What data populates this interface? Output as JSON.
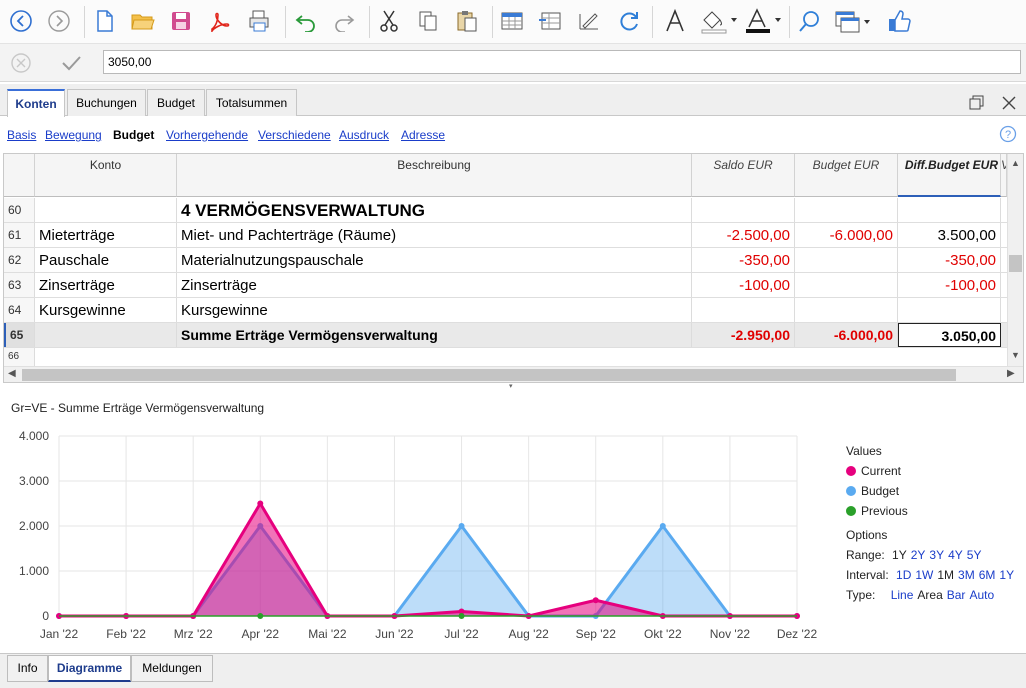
{
  "toolbar": {
    "icons": [
      "back-icon",
      "forward-icon",
      "new-file-icon",
      "open-folder-icon",
      "save-icon",
      "pdf-icon",
      "print-icon",
      "undo-icon",
      "redo-icon",
      "cut-icon",
      "copy-icon",
      "paste-icon",
      "add-rows-icon",
      "insert-rows-icon",
      "edit-icon",
      "refresh-icon",
      "font-icon",
      "fill-color-icon",
      "text-color-icon",
      "search-icon",
      "window-icon",
      "thumbs-up-icon"
    ]
  },
  "editbar": {
    "cell_value": "3050,00"
  },
  "tabs": [
    "Konten",
    "Buchungen",
    "Budget",
    "Totalsummen"
  ],
  "views": [
    "Basis",
    "Bewegung",
    "Budget",
    "Vorhergehende",
    "Verschiedene",
    "Ausdruck",
    "Adresse"
  ],
  "grid": {
    "headers": {
      "konto": "Konto",
      "beschreibung": "Beschreibung",
      "saldo": "Saldo EUR",
      "budget": "Budget EUR",
      "diff": "Diff.Budget EUR",
      "extra": "V"
    },
    "rows": [
      {
        "n": "60",
        "konto": "",
        "desc": "4 VERMÖGENSVERWALTUNG",
        "saldo": "",
        "budget": "",
        "diff": ""
      },
      {
        "n": "61",
        "konto": "Mieterträge",
        "desc": "Miet- und Pachterträge (Räume)",
        "saldo": "-2.500,00",
        "budget": "-6.000,00",
        "diff": "3.500,00"
      },
      {
        "n": "62",
        "konto": "Pauschale",
        "desc": "Materialnutzungspauschale",
        "saldo": "-350,00",
        "budget": "",
        "diff": "-350,00"
      },
      {
        "n": "63",
        "konto": "Zinserträge",
        "desc": "Zinserträge",
        "saldo": "-100,00",
        "budget": "",
        "diff": "-100,00"
      },
      {
        "n": "64",
        "konto": "Kursgewinne",
        "desc": "Kursgewinne",
        "saldo": "",
        "budget": "",
        "diff": ""
      },
      {
        "n": "65",
        "konto": "",
        "desc": "Summe Erträge Vermögensverwaltung",
        "saldo": "-2.950,00",
        "budget": "-6.000,00",
        "diff": "3.050,00"
      },
      {
        "n": "66",
        "konto": "",
        "desc": "",
        "saldo": "",
        "budget": "",
        "diff": ""
      }
    ]
  },
  "chart": {
    "title": "Gr=VE - Summe Erträge Vermögensverwaltung",
    "legend": {
      "values_label": "Values",
      "series": [
        {
          "name": "Current",
          "color": "#e6007e"
        },
        {
          "name": "Budget",
          "color": "#5aaaf0"
        },
        {
          "name": "Previous",
          "color": "#2aa02a"
        }
      ],
      "options_label": "Options",
      "range_label": "Range:",
      "range": [
        "1Y",
        "2Y",
        "3Y",
        "4Y",
        "5Y"
      ],
      "interval_label": "Interval:",
      "interval": [
        "1D",
        "1W",
        "1M",
        "3M",
        "6M",
        "1Y"
      ],
      "type_label": "Type:",
      "type": [
        "Line",
        "Area",
        "Bar",
        "Auto"
      ]
    }
  },
  "chart_data": {
    "type": "area",
    "categories": [
      "Jan '22",
      "Feb '22",
      "Mrz '22",
      "Apr '22",
      "Mai '22",
      "Jun '22",
      "Jul '22",
      "Aug '22",
      "Sep '22",
      "Okt '22",
      "Nov '22",
      "Dez '22"
    ],
    "y_ticks": [
      "0",
      "1.000",
      "2.000",
      "3.000",
      "4.000"
    ],
    "ylim": [
      0,
      4000
    ],
    "series": [
      {
        "name": "Current",
        "color": "#e6007e",
        "values": [
          0,
          0,
          0,
          2500,
          0,
          0,
          100,
          0,
          350,
          0,
          0,
          0
        ]
      },
      {
        "name": "Budget",
        "color": "#5aaaf0",
        "values": [
          0,
          0,
          0,
          2000,
          0,
          0,
          2000,
          0,
          0,
          2000,
          0,
          0
        ]
      },
      {
        "name": "Previous",
        "color": "#2aa02a",
        "values": [
          0,
          0,
          0,
          0,
          0,
          0,
          0,
          0,
          0,
          0,
          0,
          0
        ]
      }
    ]
  },
  "bottom_tabs": [
    "Info",
    "Diagramme",
    "Meldungen"
  ]
}
